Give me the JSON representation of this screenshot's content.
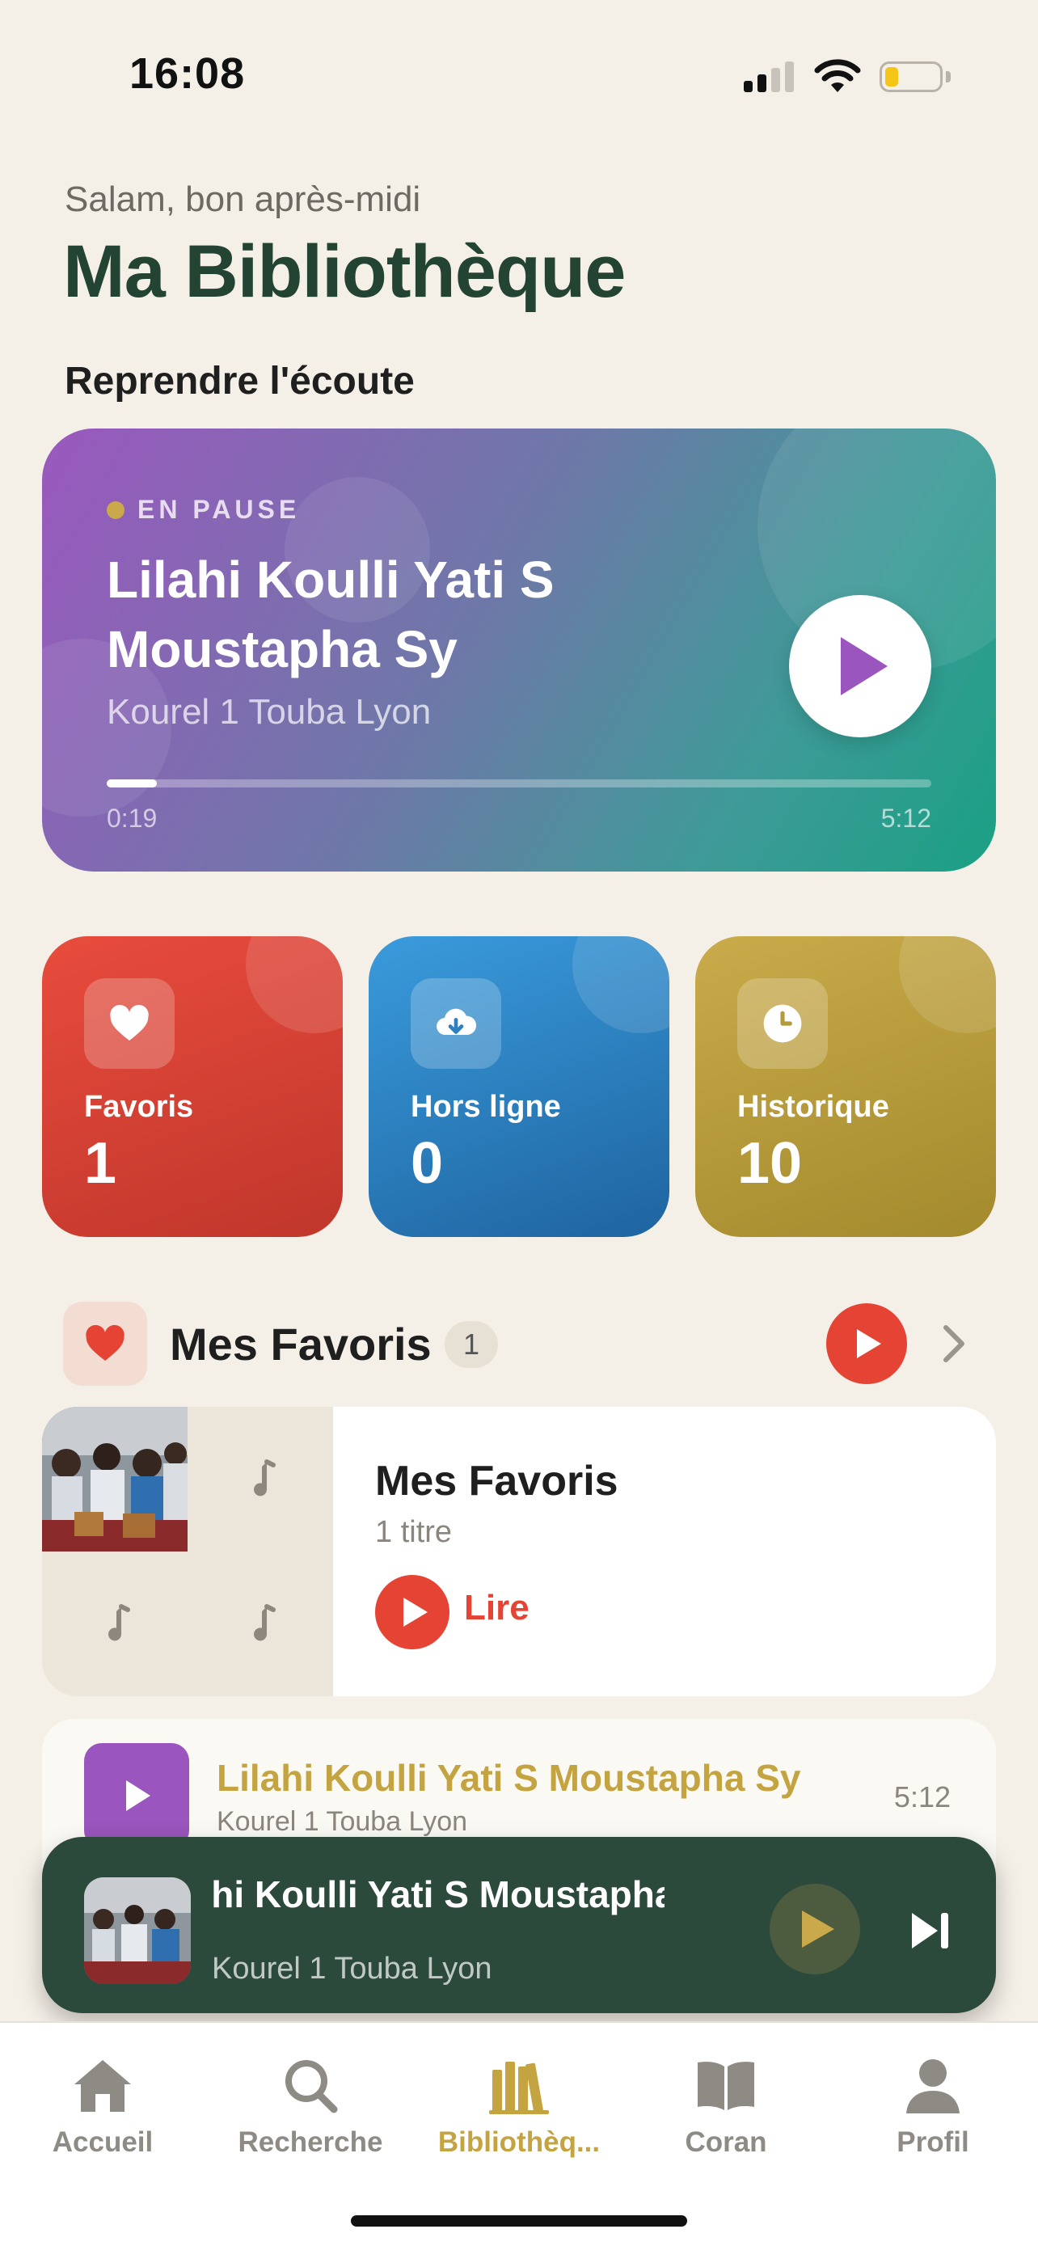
{
  "status_bar": {
    "time": "16:08"
  },
  "header": {
    "greeting": "Salam, bon après-midi",
    "title": "Ma Bibliothèque"
  },
  "resume": {
    "section_title": "Reprendre l'écoute",
    "status": "EN PAUSE",
    "title": "Lilahi Koulli Yati S Moustapha Sy",
    "artist": "Kourel 1 Touba Lyon",
    "elapsed": "0:19",
    "duration": "5:12",
    "progress": 0.061,
    "gradient_colors": [
      "#9A58BE",
      "#1AA084"
    ]
  },
  "stats": [
    {
      "label": "Favoris",
      "count": "1",
      "icon": "heart-icon",
      "color": "#E84C3D"
    },
    {
      "label": "Hors ligne",
      "count": "0",
      "icon": "cloud-download-icon",
      "color": "#3A9BDC"
    },
    {
      "label": "Historique",
      "count": "10",
      "icon": "clock-icon",
      "color": "#C9AB4A"
    }
  ],
  "favorites": {
    "title": "Mes Favoris",
    "badge": "1",
    "playlist": {
      "title": "Mes Favoris",
      "count_label": "1 titre",
      "play_label": "Lire"
    },
    "tracks": [
      {
        "title": "Lilahi Koulli Yati S Moustapha Sy",
        "artist": "Kourel 1 Touba Lyon",
        "duration": "5:12"
      }
    ]
  },
  "mini_player": {
    "title": "Lilahi Koulli Yati S Moustapha Sy",
    "artist": "Kourel 1 Touba Lyon"
  },
  "tabs": [
    {
      "label": "Accueil",
      "icon": "home-icon",
      "active": false
    },
    {
      "label": "Recherche",
      "icon": "search-icon",
      "active": false
    },
    {
      "label": "Bibliothèq...",
      "icon": "library-icon",
      "active": true
    },
    {
      "label": "Coran",
      "icon": "book-icon",
      "active": false
    },
    {
      "label": "Profil",
      "icon": "profile-icon",
      "active": false
    }
  ],
  "colors": {
    "accent_gold": "#C4A441",
    "accent_red": "#E54334",
    "title_green": "#234333",
    "background": "#F4EFE7"
  }
}
